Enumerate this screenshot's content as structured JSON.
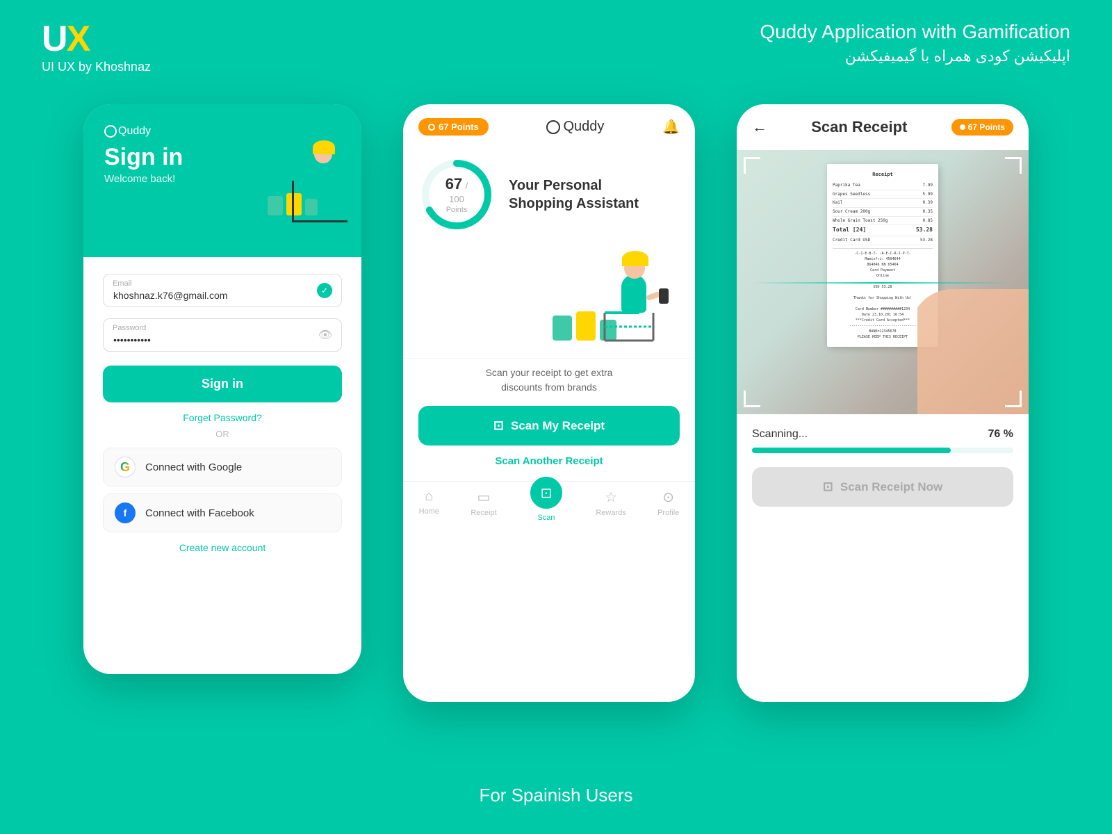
{
  "header": {
    "logo": "UX",
    "logo_highlight": "×",
    "subtitle": "UI UX by Khoshnaz",
    "title_en": "Quddy Application with Gamification",
    "title_fa": "اپلیکیشن کودی همراه با گیمیفیکشن"
  },
  "footer": {
    "text": "For Spainish Users"
  },
  "phone1": {
    "app_name": "Quddy",
    "title": "Sign in",
    "subtitle": "Welcome back!",
    "email_label": "Email",
    "email_value": "khoshnaz.k76@gmail.com",
    "password_label": "Password",
    "password_value": "••••••••••••",
    "signin_btn": "Sign in",
    "forget_pwd": "Forget Password?",
    "or_text": "OR",
    "google_btn": "Connect with Google",
    "facebook_btn": "Connect with Facebook",
    "create_account": "Create new account"
  },
  "phone2": {
    "points_badge": "67 Points",
    "app_name": "Quddy",
    "points_num": "67",
    "points_denom": "100",
    "points_label": "Points",
    "hero_text_line1": "Your Personal",
    "hero_text_line2": "Shopping Assistant",
    "scan_desc_line1": "Scan your receipt to get extra",
    "scan_desc_line2": "discounts from brands",
    "scan_btn": "Scan My Receipt",
    "scan_another": "Scan Another Receipt",
    "nav_home": "Home",
    "nav_receipt": "Receipt",
    "nav_scan": "Scan",
    "nav_rewards": "Rewards",
    "nav_profile": "Profile"
  },
  "phone3": {
    "back_arrow": "←",
    "header_title": "Scan Receipt",
    "points_badge": "67 Points",
    "scanning_label": "Scanning...",
    "progress_percent": "76 %",
    "progress_value": 76,
    "scan_now_btn": "Scan Receipt Now",
    "receipt_lines": [
      {
        "item": "Paprika Tea",
        "price": "7.99"
      },
      {
        "item": "Grapes Seedless",
        "price": "5.99"
      },
      {
        "item": "Kail",
        "price": "0.39"
      },
      {
        "item": "Sour Cream 200g",
        "price": "0.35"
      },
      {
        "item": "Whole Grain Toast 250g",
        "price": "0.85"
      },
      {
        "item": "Total [24]",
        "price": "53.28"
      },
      {
        "item": "Credit Card USD",
        "price": "53.28"
      }
    ]
  }
}
